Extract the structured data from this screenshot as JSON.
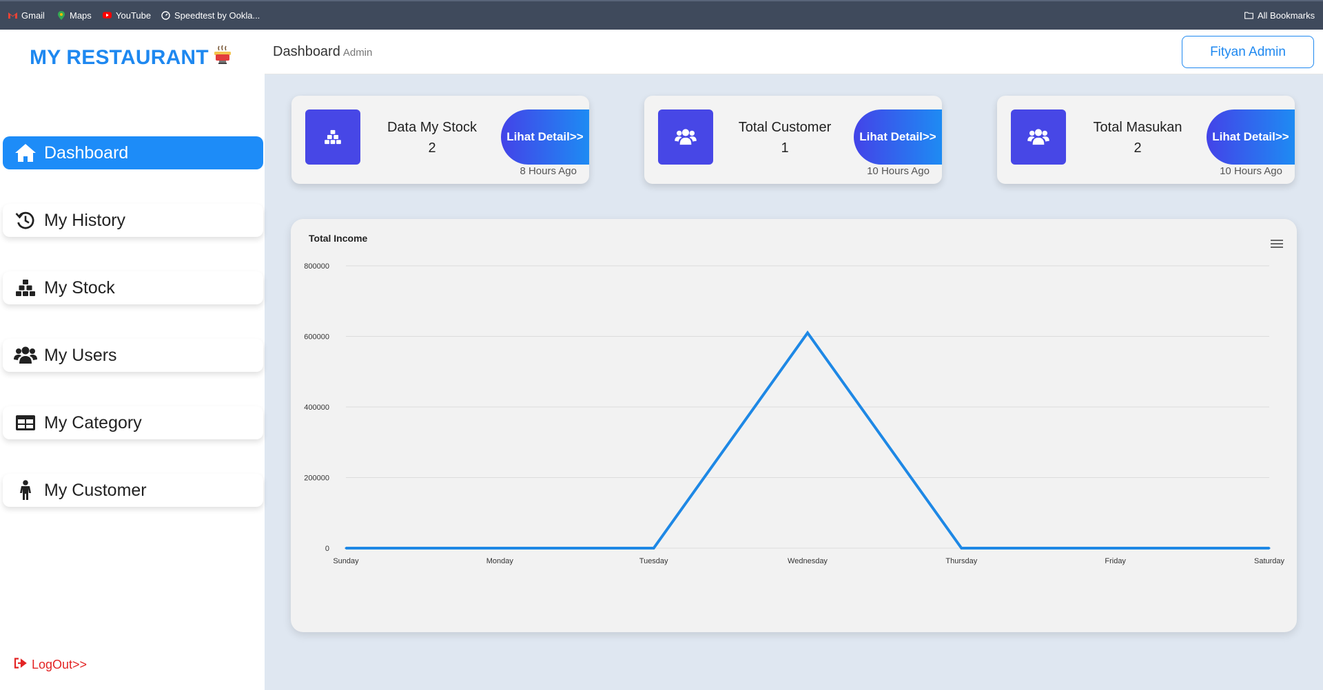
{
  "bookmarks": {
    "items": [
      {
        "label": "Gmail",
        "icon": "gmail-icon"
      },
      {
        "label": "Maps",
        "icon": "maps-pin-icon"
      },
      {
        "label": "YouTube",
        "icon": "youtube-icon"
      },
      {
        "label": "Speedtest by Ookla...",
        "icon": "speedtest-gauge-icon"
      }
    ],
    "all_bookmarks": "All Bookmarks"
  },
  "sidebar": {
    "logo": "MY RESTAURANT",
    "items": [
      {
        "label": "Dashboard",
        "icon": "home-icon",
        "active": true
      },
      {
        "label": "My History",
        "icon": "history-icon"
      },
      {
        "label": "My Stock",
        "icon": "boxes-icon"
      },
      {
        "label": "My Users",
        "icon": "users-icon"
      },
      {
        "label": "My Category",
        "icon": "table-icon"
      },
      {
        "label": "My Customer",
        "icon": "person-icon"
      }
    ],
    "logout": "LogOut>>"
  },
  "header": {
    "title": "Dashboard",
    "subtitle": "Admin",
    "user_button": "Fityan Admin"
  },
  "cards": [
    {
      "title": "Data My Stock",
      "value": "2",
      "button": "Lihat Detail>>",
      "time": "8 Hours Ago",
      "icon": "boxes-icon"
    },
    {
      "title": "Total Customer",
      "value": "1",
      "button": "Lihat Detail>>",
      "time": "10 Hours Ago",
      "icon": "users-icon"
    },
    {
      "title": "Total Masukan",
      "value": "2",
      "button": "Lihat Detail>>",
      "time": "10 Hours Ago",
      "icon": "users-icon"
    }
  ],
  "colors": {
    "accent": "#1d8cf8",
    "card_icon_bg": "#4747e6",
    "line": "#1e88e5",
    "logout": "#e32424"
  },
  "chart_data": {
    "type": "line",
    "title": "Total Income",
    "categories": [
      "Sunday",
      "Monday",
      "Tuesday",
      "Wednesday",
      "Thursday",
      "Friday",
      "Saturday"
    ],
    "series": [
      {
        "values": [
          0,
          0,
          0,
          610000,
          0,
          0,
          0
        ]
      }
    ],
    "ylim": [
      0,
      800000
    ],
    "yticks": [
      0,
      200000,
      400000,
      600000,
      800000
    ],
    "grid": true,
    "legend": "none"
  }
}
